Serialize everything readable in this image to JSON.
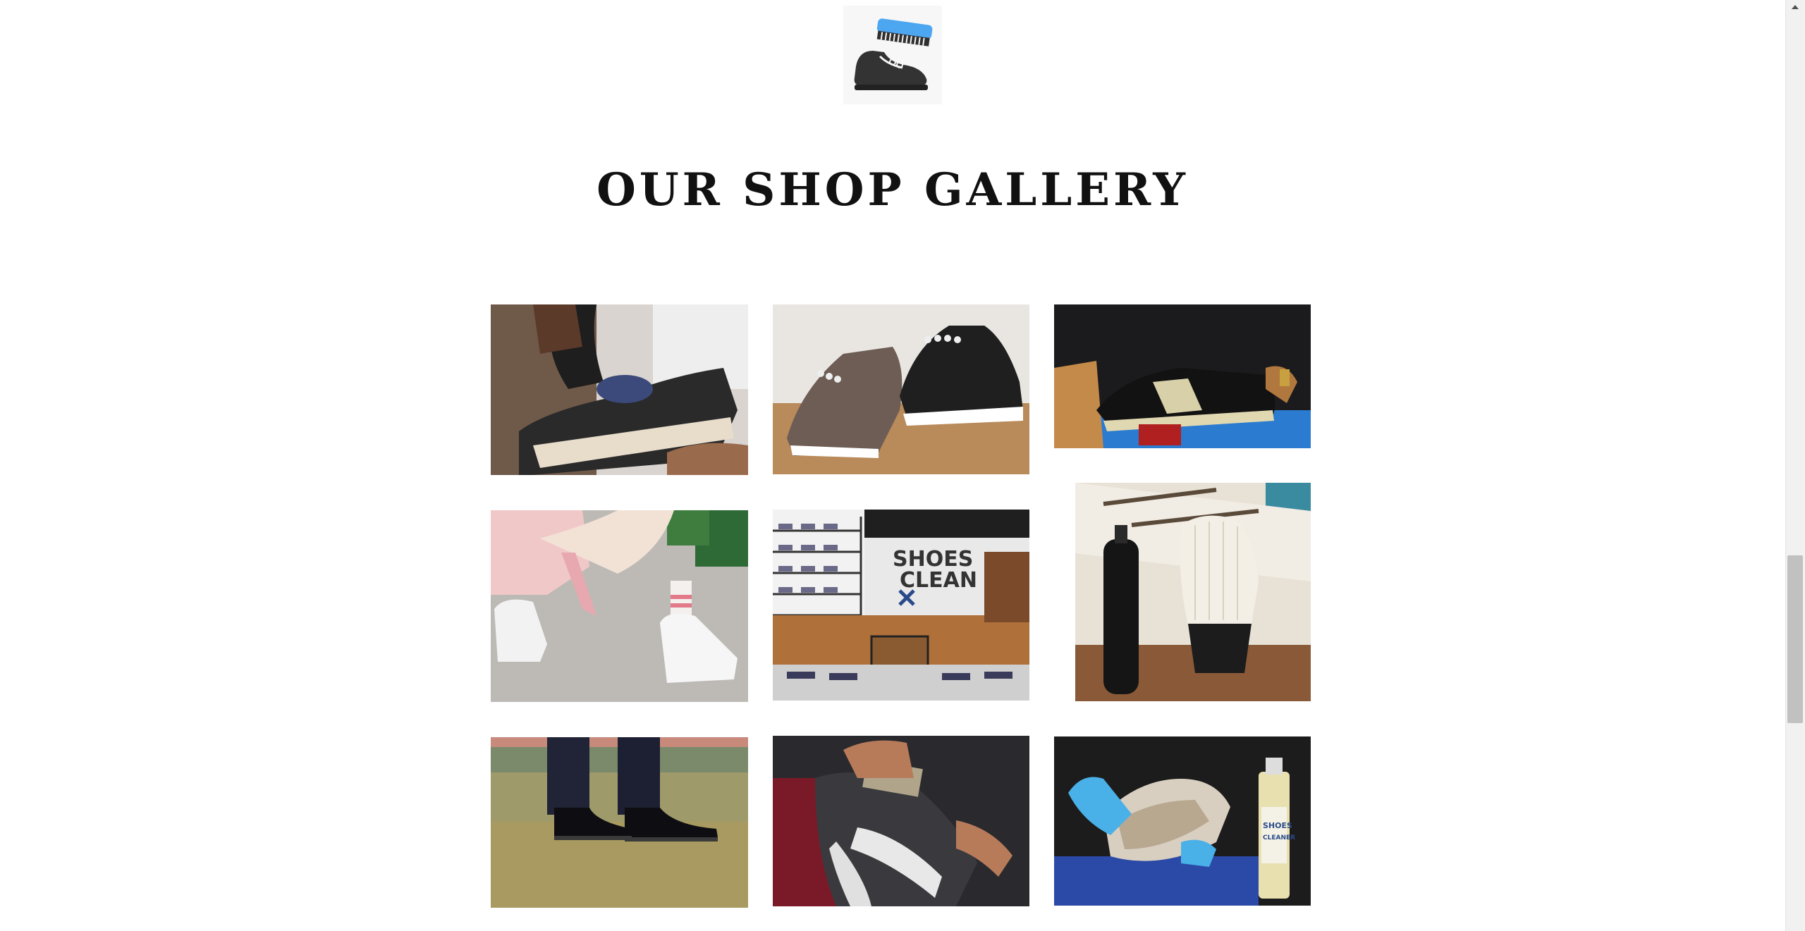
{
  "logo": {
    "icon": "shoe-brush-logo-icon",
    "accent_color": "#4da6f0"
  },
  "title": "OUR SHOP GALLERY",
  "gallery": {
    "items": [
      {
        "name": "gallery-image-cleaning-high-top-sneaker"
      },
      {
        "name": "gallery-image-brown-and-black-slip-ons"
      },
      {
        "name": "gallery-image-brushing-black-sneaker"
      },
      {
        "name": "gallery-image-white-chunky-sneakers"
      },
      {
        "name": "gallery-image-shoes-clean-shop-interior"
      },
      {
        "name": "gallery-image-cleaner-bottle-and-brush"
      },
      {
        "name": "gallery-image-black-dress-shoes-on-grass"
      },
      {
        "name": "gallery-image-brushing-running-shoe"
      },
      {
        "name": "gallery-image-sole-cleaning-gloved-hands"
      }
    ]
  }
}
